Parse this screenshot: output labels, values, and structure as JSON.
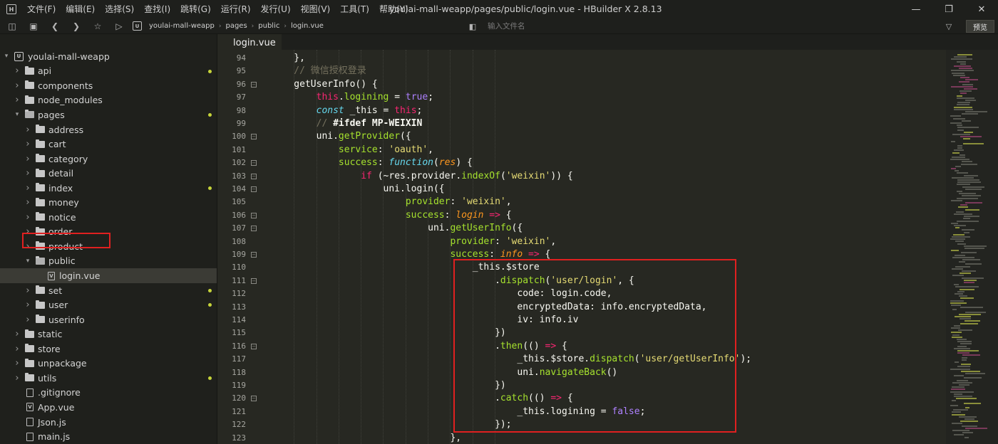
{
  "app": {
    "logo": "H",
    "menu": [
      "文件(F)",
      "编辑(E)",
      "选择(S)",
      "查找(I)",
      "跳转(G)",
      "运行(R)",
      "发行(U)",
      "视图(V)",
      "工具(T)",
      "帮助(Y)"
    ],
    "window_title": "youlai-mall-weapp/pages/public/login.vue - HBuilder X 2.8.13"
  },
  "toolbar": {
    "breadcrumbs": [
      "youlai-mall-weapp",
      "pages",
      "public",
      "login.vue"
    ],
    "file_search_placeholder": "输入文件名",
    "preview_label": "预览"
  },
  "sidebar": {
    "project": "youlai-mall-weapp",
    "items": [
      {
        "label": "api",
        "level": 1,
        "type": "folder",
        "dot": true
      },
      {
        "label": "components",
        "level": 1,
        "type": "folder",
        "dot": false
      },
      {
        "label": "node_modules",
        "level": 1,
        "type": "folder",
        "dot": false
      },
      {
        "label": "pages",
        "level": 1,
        "type": "folder-open",
        "dot": true
      },
      {
        "label": "address",
        "level": 2,
        "type": "folder",
        "dot": false
      },
      {
        "label": "cart",
        "level": 2,
        "type": "folder",
        "dot": false
      },
      {
        "label": "category",
        "level": 2,
        "type": "folder",
        "dot": false
      },
      {
        "label": "detail",
        "level": 2,
        "type": "folder",
        "dot": false
      },
      {
        "label": "index",
        "level": 2,
        "type": "folder",
        "dot": true
      },
      {
        "label": "money",
        "level": 2,
        "type": "folder",
        "dot": false
      },
      {
        "label": "notice",
        "level": 2,
        "type": "folder",
        "dot": false
      },
      {
        "label": "order",
        "level": 2,
        "type": "folder",
        "dot": false
      },
      {
        "label": "product",
        "level": 2,
        "type": "folder",
        "dot": false
      },
      {
        "label": "public",
        "level": 2,
        "type": "folder-open",
        "dot": false
      },
      {
        "label": "login.vue",
        "level": 3,
        "type": "vue",
        "dot": false,
        "selected": true
      },
      {
        "label": "set",
        "level": 2,
        "type": "folder",
        "dot": true
      },
      {
        "label": "user",
        "level": 2,
        "type": "folder",
        "dot": true
      },
      {
        "label": "userinfo",
        "level": 2,
        "type": "folder",
        "dot": false
      },
      {
        "label": "static",
        "level": 1,
        "type": "folder",
        "dot": false
      },
      {
        "label": "store",
        "level": 1,
        "type": "folder",
        "dot": false
      },
      {
        "label": "unpackage",
        "level": 1,
        "type": "folder",
        "dot": false
      },
      {
        "label": "utils",
        "level": 1,
        "type": "folder",
        "dot": true
      },
      {
        "label": ".gitignore",
        "level": 1,
        "type": "file",
        "dot": false
      },
      {
        "label": "App.vue",
        "level": 1,
        "type": "vue",
        "dot": false
      },
      {
        "label": "Json.js",
        "level": 1,
        "type": "file",
        "dot": false
      },
      {
        "label": "main.js",
        "level": 1,
        "type": "file",
        "dot": false
      }
    ]
  },
  "editor": {
    "tab": "login.vue",
    "lines": [
      {
        "n": "94",
        "fold": false
      },
      {
        "n": "95",
        "fold": false
      },
      {
        "n": "96",
        "fold": true
      },
      {
        "n": "97",
        "fold": false
      },
      {
        "n": "98",
        "fold": false
      },
      {
        "n": "99",
        "fold": false
      },
      {
        "n": "100",
        "fold": true
      },
      {
        "n": "101",
        "fold": false
      },
      {
        "n": "102",
        "fold": true
      },
      {
        "n": "103",
        "fold": true
      },
      {
        "n": "104",
        "fold": true
      },
      {
        "n": "105",
        "fold": false
      },
      {
        "n": "106",
        "fold": true
      },
      {
        "n": "107",
        "fold": true
      },
      {
        "n": "108",
        "fold": false
      },
      {
        "n": "109",
        "fold": true
      },
      {
        "n": "110",
        "fold": false
      },
      {
        "n": "111",
        "fold": true
      },
      {
        "n": "112",
        "fold": false
      },
      {
        "n": "113",
        "fold": false
      },
      {
        "n": "114",
        "fold": false
      },
      {
        "n": "115",
        "fold": false
      },
      {
        "n": "116",
        "fold": true
      },
      {
        "n": "117",
        "fold": false
      },
      {
        "n": "118",
        "fold": false
      },
      {
        "n": "119",
        "fold": false
      },
      {
        "n": "120",
        "fold": true
      },
      {
        "n": "121",
        "fold": false
      },
      {
        "n": "122",
        "fold": false
      },
      {
        "n": "123",
        "fold": false
      }
    ],
    "code": [
      [
        [
          "p",
          "    },"
        ]
      ],
      [
        [
          "cm",
          "    // 微信授权登录"
        ]
      ],
      [
        [
          "p",
          "    getUserInfo() {"
        ]
      ],
      [
        [
          "p",
          "        "
        ],
        [
          "this",
          "this"
        ],
        [
          "p",
          "."
        ],
        [
          "prop",
          "logining"
        ],
        [
          "p",
          " = "
        ],
        [
          "bool",
          "true"
        ],
        [
          "p",
          ";"
        ]
      ],
      [
        [
          "p",
          "        "
        ],
        [
          "kwb",
          "const"
        ],
        [
          "p",
          " _this = "
        ],
        [
          "this",
          "this"
        ],
        [
          "p",
          ";"
        ]
      ],
      [
        [
          "cm",
          "        // "
        ],
        [
          "cmb",
          "#ifdef"
        ],
        [
          "p",
          " "
        ],
        [
          "cmb",
          "MP-WEIXIN"
        ]
      ],
      [
        [
          "p",
          "        uni."
        ],
        [
          "fn",
          "getProvider"
        ],
        [
          "p",
          "({"
        ]
      ],
      [
        [
          "p",
          "            "
        ],
        [
          "prop",
          "service"
        ],
        [
          "p",
          ": "
        ],
        [
          "str",
          "'oauth'"
        ],
        [
          "p",
          ","
        ]
      ],
      [
        [
          "p",
          "            "
        ],
        [
          "prop",
          "success"
        ],
        [
          "p",
          ": "
        ],
        [
          "kwb",
          "function"
        ],
        [
          "p",
          "("
        ],
        [
          "param",
          "res"
        ],
        [
          "p",
          ") {"
        ]
      ],
      [
        [
          "p",
          "                "
        ],
        [
          "kw",
          "if"
        ],
        [
          "p",
          " (~res."
        ],
        [
          "p",
          "provider"
        ],
        [
          "p",
          "."
        ],
        [
          "fn",
          "indexOf"
        ],
        [
          "p",
          "("
        ],
        [
          "str",
          "'weixin'"
        ],
        [
          "p",
          ")) {"
        ]
      ],
      [
        [
          "p",
          "                    uni."
        ],
        [
          "p",
          "login"
        ],
        [
          "p",
          "({"
        ]
      ],
      [
        [
          "p",
          "                        "
        ],
        [
          "prop",
          "provider"
        ],
        [
          "p",
          ": "
        ],
        [
          "str",
          "'weixin'"
        ],
        [
          "p",
          ","
        ]
      ],
      [
        [
          "p",
          "                        "
        ],
        [
          "prop",
          "success"
        ],
        [
          "p",
          ": "
        ],
        [
          "param",
          "login"
        ],
        [
          "p",
          " "
        ],
        [
          "kw",
          "=>"
        ],
        [
          "p",
          " {"
        ]
      ],
      [
        [
          "p",
          "                            uni."
        ],
        [
          "fn",
          "getUserInfo"
        ],
        [
          "p",
          "({"
        ]
      ],
      [
        [
          "p",
          "                                "
        ],
        [
          "prop",
          "provider"
        ],
        [
          "p",
          ": "
        ],
        [
          "str",
          "'weixin'"
        ],
        [
          "p",
          ","
        ]
      ],
      [
        [
          "p",
          "                                "
        ],
        [
          "prop",
          "success"
        ],
        [
          "p",
          ": "
        ],
        [
          "param",
          "info"
        ],
        [
          "p",
          " "
        ],
        [
          "kw",
          "=>"
        ],
        [
          "p",
          " {"
        ]
      ],
      [
        [
          "p",
          "                                    _this.$store"
        ]
      ],
      [
        [
          "p",
          "                                        ."
        ],
        [
          "fn",
          "dispatch"
        ],
        [
          "p",
          "("
        ],
        [
          "str",
          "'user/login'"
        ],
        [
          "p",
          ", {"
        ]
      ],
      [
        [
          "p",
          "                                            code: login."
        ],
        [
          "p",
          "code"
        ],
        [
          "p",
          ","
        ]
      ],
      [
        [
          "p",
          "                                            encryptedData: info."
        ],
        [
          "p",
          "encryptedData"
        ],
        [
          "p",
          ","
        ]
      ],
      [
        [
          "p",
          "                                            iv: info."
        ],
        [
          "p",
          "iv"
        ]
      ],
      [
        [
          "p",
          "                                        })"
        ]
      ],
      [
        [
          "p",
          "                                        ."
        ],
        [
          "fn",
          "then"
        ],
        [
          "p",
          "(() "
        ],
        [
          "kw",
          "=>"
        ],
        [
          "p",
          " {"
        ]
      ],
      [
        [
          "p",
          "                                            _this.$store."
        ],
        [
          "fn",
          "dispatch"
        ],
        [
          "p",
          "("
        ],
        [
          "str",
          "'user/getUserInfo'"
        ],
        [
          "p",
          ");"
        ]
      ],
      [
        [
          "p",
          "                                            uni."
        ],
        [
          "fn",
          "navigateBack"
        ],
        [
          "p",
          "()"
        ]
      ],
      [
        [
          "p",
          "                                        })"
        ]
      ],
      [
        [
          "p",
          "                                        ."
        ],
        [
          "fn",
          "catch"
        ],
        [
          "p",
          "(() "
        ],
        [
          "kw",
          "=>"
        ],
        [
          "p",
          " {"
        ]
      ],
      [
        [
          "p",
          "                                            _this."
        ],
        [
          "p",
          "logining"
        ],
        [
          "p",
          " = "
        ],
        [
          "bool",
          "false"
        ],
        [
          "p",
          ";"
        ]
      ],
      [
        [
          "p",
          "                                        });"
        ]
      ],
      [
        [
          "p",
          "                                },"
        ]
      ]
    ]
  }
}
